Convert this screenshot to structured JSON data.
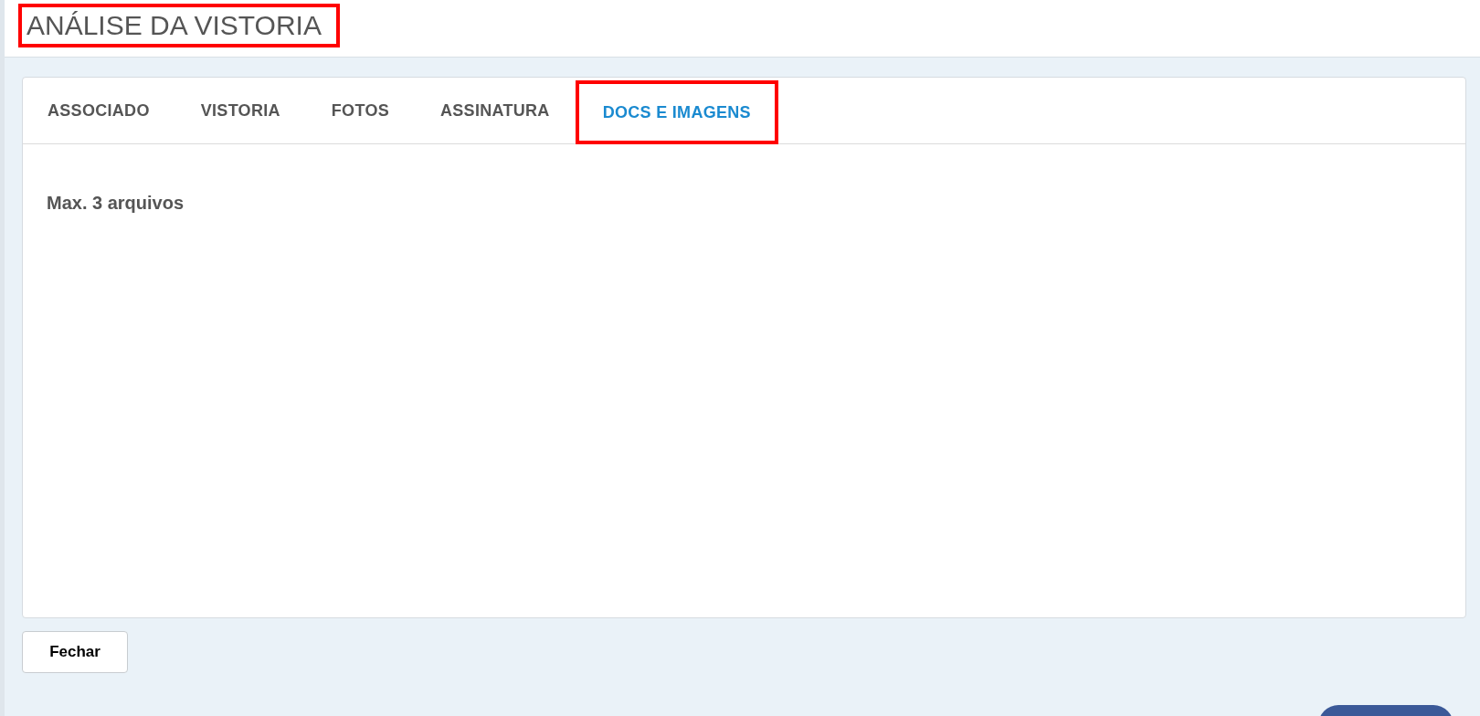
{
  "header": {
    "title": "ANÁLISE DA VISTORIA",
    "highlighted": true
  },
  "tabs": [
    {
      "label": "ASSOCIADO",
      "selected": false,
      "highlighted": false
    },
    {
      "label": "VISTORIA",
      "selected": false,
      "highlighted": false
    },
    {
      "label": "FOTOS",
      "selected": false,
      "highlighted": false
    },
    {
      "label": "ASSINATURA",
      "selected": false,
      "highlighted": false
    },
    {
      "label": "DOCS E IMAGENS",
      "selected": true,
      "highlighted": true
    }
  ],
  "panel": {
    "note": "Max. 3 arquivos"
  },
  "buttons": [
    "Fechar"
  ]
}
